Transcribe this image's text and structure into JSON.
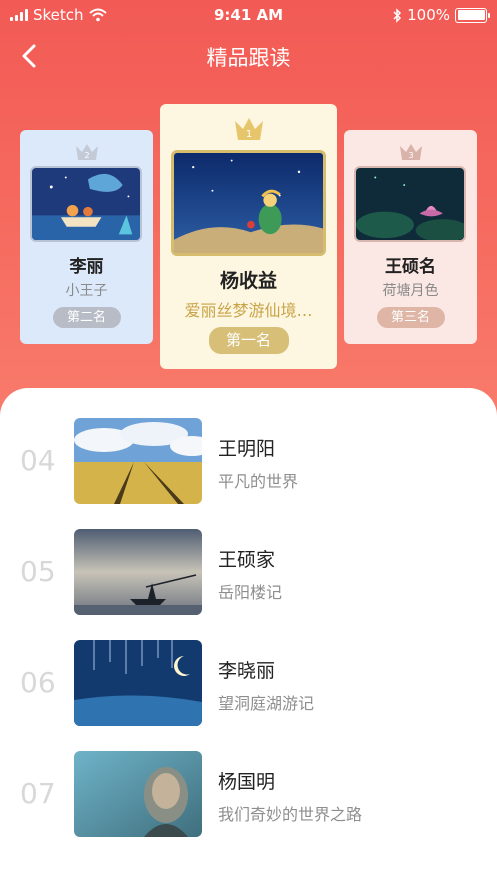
{
  "status_bar": {
    "carrier": "Sketch",
    "time": "9:41 AM",
    "battery": "100%"
  },
  "nav": {
    "title": "精品跟读",
    "back_icon": "chevron-left-icon"
  },
  "podium": {
    "first": {
      "rank_number": "1",
      "name": "杨收益",
      "book": "爱丽丝梦游仙境…",
      "badge": "第一名"
    },
    "second": {
      "rank_number": "2",
      "name": "李丽",
      "book": "小王子",
      "badge": "第二名"
    },
    "third": {
      "rank_number": "3",
      "name": "王硕名",
      "book": "荷塘月色",
      "badge": "第三名"
    }
  },
  "list": [
    {
      "rank": "04",
      "name": "王明阳",
      "book": "平凡的世界"
    },
    {
      "rank": "05",
      "name": "王硕家",
      "book": "岳阳楼记"
    },
    {
      "rank": "06",
      "name": "李晓丽",
      "book": "望洞庭湖游记"
    },
    {
      "rank": "07",
      "name": "杨国明",
      "book": "我们奇妙的世界之路"
    }
  ],
  "colors": {
    "header": "#f25a55",
    "gold": "#d7bf78",
    "silver": "#b7bcc7",
    "bronze": "#dfb6a6"
  }
}
